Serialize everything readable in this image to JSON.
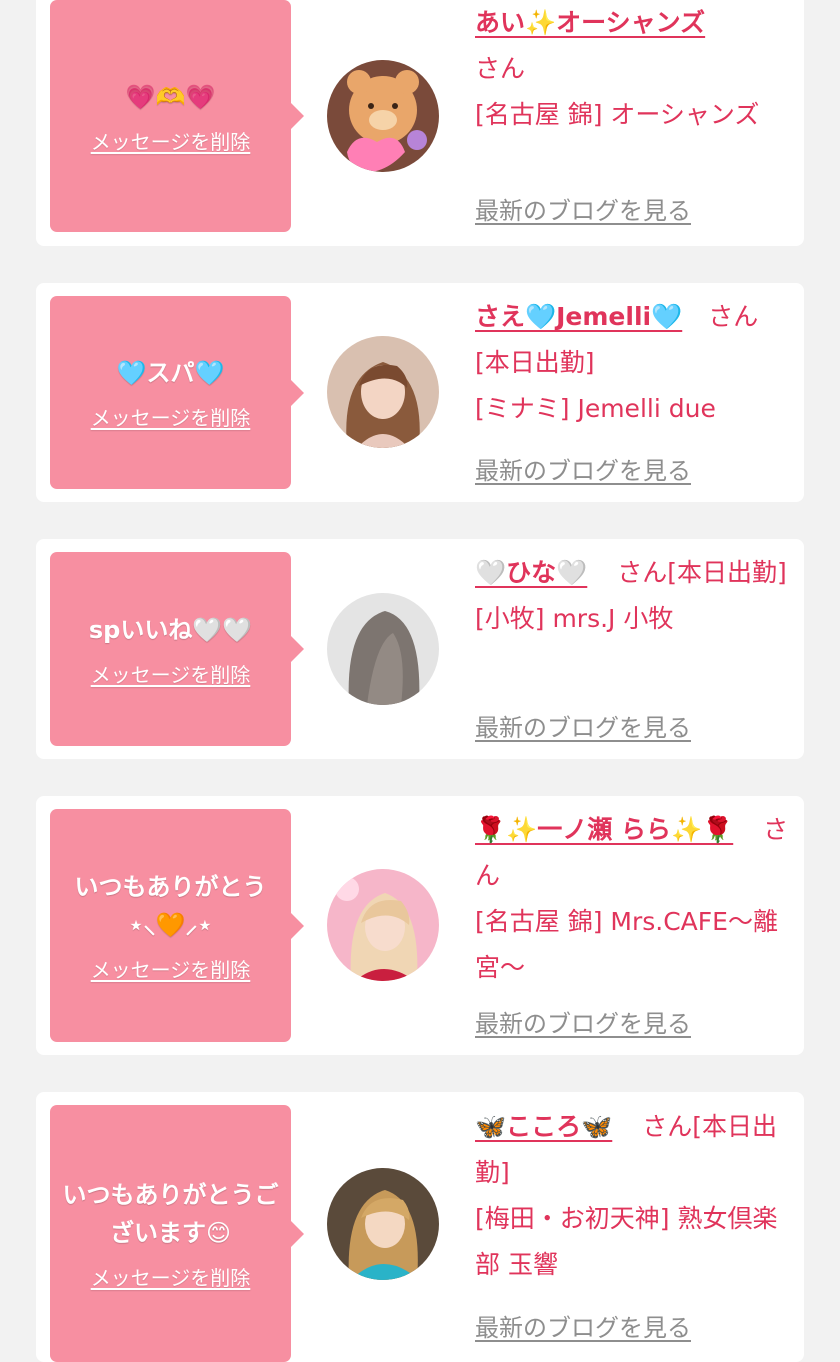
{
  "cards": [
    {
      "message": "💗🫶💗",
      "delete_label": "メッセージを削除",
      "name": "あい✨オーシャンズ",
      "san": "さん",
      "status": "",
      "shop": "[名古屋 錦] オーシャンズ",
      "blog_label": "最新のブログを見る"
    },
    {
      "message": "🩵スパ🩵",
      "delete_label": "メッセージを削除",
      "name": "さえ🩵Jemelli🩵",
      "san": "さん",
      "status": "[本日出勤]",
      "shop": "[ミナミ] Jemelli due",
      "blog_label": "最新のブログを見る"
    },
    {
      "message": "spいいね🤍🤍",
      "delete_label": "メッセージを削除",
      "name": "🤍ひな🤍",
      "san": "さん",
      "status": "[本日出勤]",
      "shop": "[小牧] mrs.J 小牧",
      "blog_label": "最新のブログを見る"
    },
    {
      "message": "いつもありがとう⋆⸜🧡⸝⋆",
      "delete_label": "メッセージを削除",
      "name": "🌹✨一ノ瀬 らら✨🌹",
      "san": "さん",
      "status": "",
      "shop": "[名古屋 錦] Mrs.CAFE〜離宮〜",
      "blog_label": "最新のブログを見る"
    },
    {
      "message": "いつもありがとうございます😊",
      "delete_label": "メッセージを削除",
      "name": "🦋こころ🦋",
      "san": "さん",
      "status": "[本日出勤]",
      "shop": "[梅田・お初天神] 熟女倶楽部 玉響",
      "blog_label": "最新のブログを見る"
    }
  ]
}
